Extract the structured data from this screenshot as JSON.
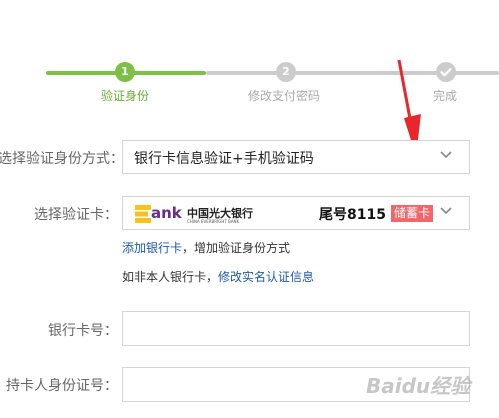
{
  "steps": [
    {
      "number": "1",
      "label": "验证身份"
    },
    {
      "number": "2",
      "label": "修改支付密码"
    },
    {
      "number": "",
      "label": "完成"
    }
  ],
  "colors": {
    "active": "#7dbf47",
    "inactive": "#cccccc",
    "link": "#1d5aa8",
    "badge": "#f0676b"
  },
  "form": {
    "method": {
      "label": "选择验证身份方式：",
      "value": "银行卡信息验证+手机验证码"
    },
    "card": {
      "label": "选择验证卡：",
      "bank_logo_mark": "ank",
      "bank_name_cn": "中国光大银行",
      "bank_name_en": "CHINA EVERBRIGHT BANK",
      "tail": "尾号8115",
      "type_badge": "储蓄卡"
    },
    "add_card_link": "添加银行卡",
    "add_card_suffix": "，增加验证身份方式",
    "not_self_prefix": "如非本人银行卡，",
    "modify_link": "修改实名认证信息",
    "card_number": {
      "label": "银行卡号：",
      "value": ""
    },
    "id_number": {
      "label": "持卡人身份证号：",
      "value": ""
    }
  },
  "watermark": "Baidu经验"
}
